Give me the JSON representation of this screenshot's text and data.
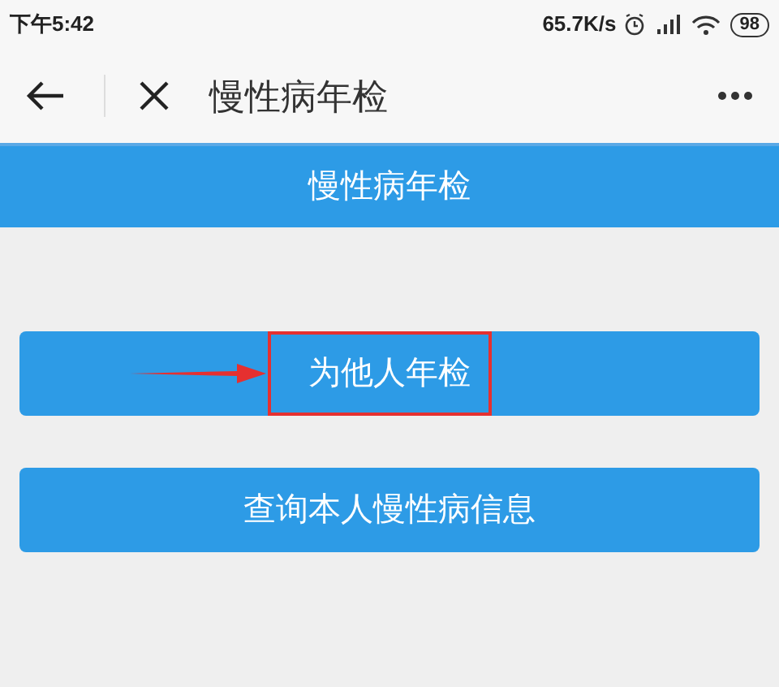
{
  "status_bar": {
    "time": "下午5:42",
    "speed": "65.7K/s",
    "battery": "98"
  },
  "nav_bar": {
    "title": "慢性病年检"
  },
  "header": {
    "title": "慢性病年检"
  },
  "buttons": [
    {
      "label": "为他人年检",
      "highlighted": true
    },
    {
      "label": "查询本人慢性病信息",
      "highlighted": false
    }
  ]
}
